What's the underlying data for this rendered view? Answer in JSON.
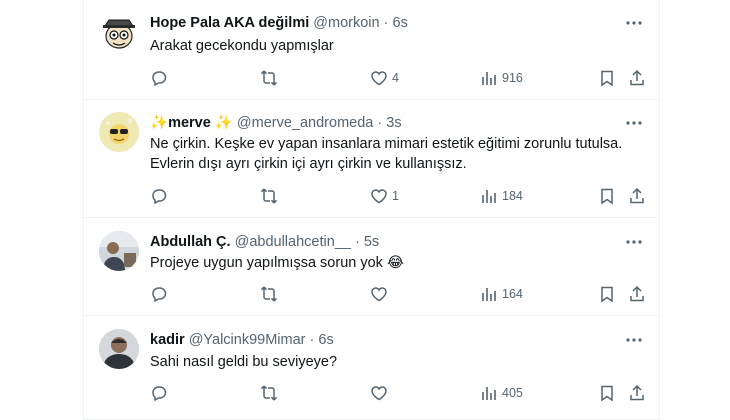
{
  "tweets": [
    {
      "name": "Hope Pala AKA değilmi",
      "handle": "@morkoin",
      "separator": "·",
      "time": "6s",
      "lines": [
        "Arakat gecekondu yapmışlar"
      ],
      "likes": "4",
      "views": "916",
      "replies": "",
      "reposts": ""
    },
    {
      "name_prefix": "✨",
      "name": "merve",
      "name_suffix": "✨",
      "handle": "@merve_andromeda",
      "separator": "·",
      "time": "3s",
      "lines": [
        "Ne çirkin. Keşke ev yapan insanlara mimari estetik eğitimi zorunlu tutulsa.",
        "Evlerin dışı ayrı çirkin içi ayrı çirkin ve kullanışsız."
      ],
      "likes": "1",
      "views": "184",
      "replies": "",
      "reposts": ""
    },
    {
      "name": "Abdullah Ç.",
      "handle": "@abdullahcetin__",
      "separator": "·",
      "time": "5s",
      "lines": [
        "Projeye uygun yapılmışsa sorun yok 😂"
      ],
      "likes": "",
      "views": "164",
      "replies": "",
      "reposts": ""
    },
    {
      "name": "kadir",
      "handle": "@Yalcink99Mimar",
      "separator": "·",
      "time": "6s",
      "lines": [
        "Sahi nasıl geldi bu seviyeye?"
      ],
      "likes": "",
      "views": "405",
      "replies": "",
      "reposts": ""
    }
  ],
  "icons": {
    "reply": "reply-icon",
    "repost": "repost-icon",
    "like": "like-icon",
    "views": "views-icon",
    "bookmark": "bookmark-icon",
    "share": "share-icon",
    "more": "more-icon"
  },
  "colors": {
    "text": "#0f1419",
    "muted": "#536471",
    "border": "#eff3f4"
  }
}
